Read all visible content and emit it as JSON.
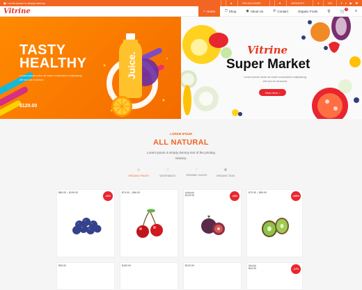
{
  "topbar": {
    "promo": "Lorem Ipsum is simply dummy",
    "account": "MY ACCOUNT",
    "wishlist": "WISHLIST",
    "lang": "EN"
  },
  "brand": {
    "logo": "Vitrine"
  },
  "menu": {
    "items": [
      {
        "label": "Home",
        "icon": "home-icon"
      },
      {
        "label": "Shop",
        "icon": "bag-icon"
      },
      {
        "label": "About Us",
        "icon": "user-icon"
      },
      {
        "label": "Contact",
        "icon": "phone-icon"
      },
      {
        "label": "Organic Fruits"
      }
    ],
    "cart_count": "0"
  },
  "hero_left": {
    "title_line1": "TASTY",
    "title_line2": "HEALTHY",
    "subtitle": "Lorem ipsum dolor sit amet consectetur adipisicing elit sed do eiusmod",
    "price": "$129.00",
    "bottle_label": "Juice."
  },
  "hero_right": {
    "script": "Vitrine",
    "title": "Super Market",
    "subtitle": "Lorem ipsum dolor sit amet consectetur adipisicing elit sed do eiusmod",
    "button": "Click Here"
  },
  "section": {
    "kicker": "LOREM IPSUM",
    "title": "ALL NATURAL",
    "desc": "Lorem Ipsum is simply dummy text of the printing industry."
  },
  "tabs": [
    {
      "label": "ORGANIC FRUITS",
      "icon": "star-icon"
    },
    {
      "label": "VEGETABLES",
      "icon": "heart-icon"
    },
    {
      "label": "ORGANIC JUICES",
      "icon": "chat-icon"
    },
    {
      "label": "ORGANIC TEAS",
      "icon": "leaf-icon"
    }
  ],
  "products": [
    {
      "old": "",
      "price": "$89.00 – $199.00",
      "badge": "-11%",
      "fruit": "blueberries"
    },
    {
      "old": "",
      "price": "$79.00 – $96.00",
      "badge": "",
      "fruit": "cherries"
    },
    {
      "old": "$150.00",
      "price": "$129.00",
      "badge": "-13%",
      "fruit": "figs"
    },
    {
      "old": "",
      "price": "$70.00 – $99.00",
      "badge": "-100%",
      "fruit": "kiwi"
    }
  ],
  "products_row2": [
    {
      "old": "",
      "price": "$99.00",
      "badge": ""
    },
    {
      "old": "",
      "price": "$150.00",
      "badge": ""
    },
    {
      "old": "",
      "price": "$129.00",
      "badge": ""
    },
    {
      "old": "$97.00",
      "price": "$44.00",
      "badge": "-17%"
    }
  ],
  "colors": {
    "accent": "#f26522",
    "sale": "#e8262f"
  }
}
